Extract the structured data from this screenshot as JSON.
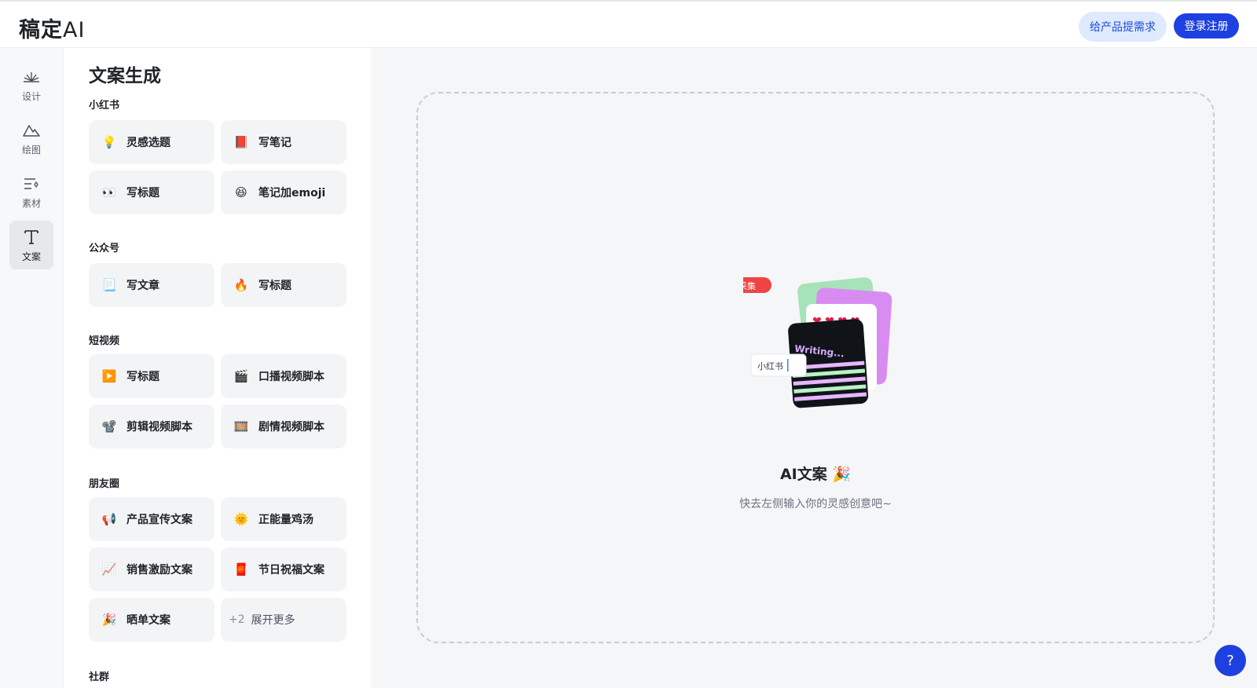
{
  "header": {
    "logo_main": "稿定",
    "logo_ai": "AI",
    "feedback_button": "给产品提需求",
    "login_button": "登录注册"
  },
  "rail": [
    {
      "label": "设计",
      "icon": "design-icon"
    },
    {
      "label": "绘图",
      "icon": "mountain-icon"
    },
    {
      "label": "素材",
      "icon": "list-sparkle-icon"
    },
    {
      "label": "文案",
      "icon": "text-icon",
      "active": true
    }
  ],
  "panel": {
    "title": "文案生成",
    "sections": {
      "xhs": {
        "label": "小红书",
        "items": [
          {
            "emoji": "💡",
            "label": "灵感选题"
          },
          {
            "emoji": "📕",
            "label": "写笔记"
          },
          {
            "emoji": "👀",
            "label": "写标题"
          },
          {
            "emoji": "😆",
            "label": "笔记加emoji"
          }
        ]
      },
      "gzh": {
        "label": "公众号",
        "items": [
          {
            "emoji": "📃",
            "label": "写文章"
          },
          {
            "emoji": "🔥",
            "label": "写标题"
          }
        ]
      },
      "video": {
        "label": "短视频",
        "items": [
          {
            "emoji": "▶️",
            "label": "写标题"
          },
          {
            "emoji": "🎬",
            "label": "口播视频脚本"
          },
          {
            "emoji": "📽️",
            "label": "剪辑视频脚本"
          },
          {
            "emoji": "🎞️",
            "label": "剧情视频脚本"
          }
        ]
      },
      "moments": {
        "label": "朋友圈",
        "items": [
          {
            "emoji": "📢",
            "label": "产品宣传文案"
          },
          {
            "emoji": "🌞",
            "label": "正能量鸡汤"
          },
          {
            "emoji": "📈",
            "label": "销售激励文案"
          },
          {
            "emoji": "🧧",
            "label": "节日祝福文案"
          },
          {
            "emoji": "🎉",
            "label": "晒单文案"
          }
        ],
        "more": {
          "count": "+2",
          "label": "展开更多"
        }
      },
      "community": {
        "label": "社群"
      }
    }
  },
  "main": {
    "illustration": {
      "badge": "采集",
      "input_text": "小红书",
      "card_text": "Writing..."
    },
    "empty_title": "AI文案 🎉",
    "empty_subtitle": "快去左侧输入你的灵感创意吧~"
  },
  "help": "?",
  "colors": {
    "accent": "#1e40e0",
    "accent_soft": "#dfe9ff",
    "card_bg": "#f3f4f6",
    "main_bg": "#f5f6f8"
  }
}
